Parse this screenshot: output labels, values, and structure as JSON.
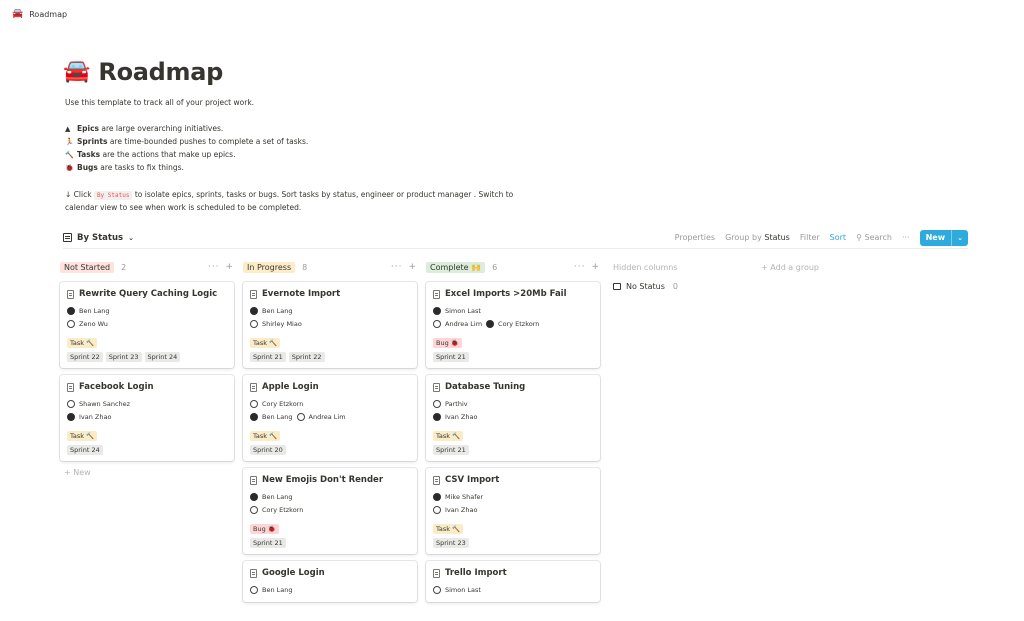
{
  "topbar": {
    "icon": "bus-icon",
    "breadcrumb": "Roadmap"
  },
  "page": {
    "title": "Roadmap",
    "intro": "Use this template to track all of your project work.",
    "defs": [
      {
        "icon": "mountain-icon",
        "term": "Epics",
        "text": " are large overarching initiatives."
      },
      {
        "icon": "runner-icon",
        "term": "Sprints",
        "text": " are time-bounded pushes to complete a set of tasks."
      },
      {
        "icon": "hammer-icon",
        "term": "Tasks",
        "text": " are the actions that make up epics."
      },
      {
        "icon": "bug-icon",
        "term": "Bugs",
        "text": " are tasks to fix things."
      }
    ],
    "tip_prefix": "↓ Click ",
    "tip_chip": "By Status",
    "tip_line1": " to isolate epics, sprints, tasks or bugs. Sort tasks by status, engineer or product manager . Switch to",
    "tip_line2": "calendar view to see when work is scheduled to be completed."
  },
  "view": {
    "name": "By Status",
    "actions": {
      "properties": "Properties",
      "group_by": "Group by",
      "group_value": "Status",
      "filter": "Filter",
      "sort": "Sort",
      "search": "Search",
      "more": "···",
      "new": "New"
    }
  },
  "columns": [
    {
      "status": "Not Started",
      "color": "#ffe2dd",
      "count": "2",
      "cards": [
        {
          "title": "Rewrite Query Caching Logic",
          "people": [
            [
              "Ben Lang"
            ],
            [
              "Zeno Wu"
            ]
          ],
          "tag": "Task 🔨",
          "tag_type": "task",
          "sprints": [
            "Sprint 22",
            "Sprint 23",
            "Sprint 24"
          ]
        },
        {
          "title": "Facebook Login",
          "people": [
            [
              "Shawn Sanchez"
            ],
            [
              "Ivan Zhao"
            ]
          ],
          "tag": "Task 🔨",
          "tag_type": "task",
          "sprints": [
            "Sprint 24"
          ]
        }
      ],
      "add_label": "+ New"
    },
    {
      "status": "In Progress",
      "color": "#fdecc8",
      "count": "8",
      "cards": [
        {
          "title": "Evernote Import",
          "people": [
            [
              "Ben Lang"
            ],
            [
              "Shirley Miao"
            ]
          ],
          "tag": "Task 🔨",
          "tag_type": "task",
          "sprints": [
            "Sprint 21",
            "Sprint 22"
          ]
        },
        {
          "title": "Apple Login",
          "people": [
            [
              "Cory Etzkorn"
            ],
            [
              "Ben Lang",
              "Andrea Lim"
            ]
          ],
          "tag": "Task 🔨",
          "tag_type": "task",
          "sprints": [
            "Sprint 20"
          ]
        },
        {
          "title": "New Emojis Don't Render",
          "people": [
            [
              "Ben Lang"
            ],
            [
              "Cory Etzkorn"
            ]
          ],
          "tag": "Bug 🐞",
          "tag_type": "bug",
          "sprints": [
            "Sprint 21"
          ]
        },
        {
          "title": "Google Login",
          "people": [
            [
              "Ben Lang"
            ]
          ],
          "tag": "",
          "tag_type": "task",
          "sprints": []
        }
      ]
    },
    {
      "status": "Complete 🙌",
      "color": "#dbeddb",
      "count": "6",
      "cards": [
        {
          "title": "Excel Imports >20Mb Fail",
          "people": [
            [
              "Simon Last"
            ],
            [
              "Andrea Lim",
              "Cory Etzkorn"
            ]
          ],
          "tag": "Bug 🐞",
          "tag_type": "bug",
          "sprints": [
            "Sprint 21"
          ]
        },
        {
          "title": "Database Tuning",
          "people": [
            [
              "Parthiv"
            ],
            [
              "Ivan Zhao"
            ]
          ],
          "tag": "Task 🔨",
          "tag_type": "task",
          "sprints": [
            "Sprint 21"
          ]
        },
        {
          "title": "CSV Import",
          "people": [
            [
              "Mike Shafer"
            ],
            [
              "Ivan Zhao"
            ]
          ],
          "tag": "Task 🔨",
          "tag_type": "task",
          "sprints": [
            "Sprint 23"
          ]
        },
        {
          "title": "Trello Import",
          "people": [
            [
              "Simon Last"
            ]
          ],
          "tag": "",
          "tag_type": "task",
          "sprints": []
        }
      ]
    }
  ],
  "hidden": {
    "label": "Hidden columns",
    "add_group": "+ Add a group",
    "no_status": "No Status",
    "no_status_count": "0"
  }
}
